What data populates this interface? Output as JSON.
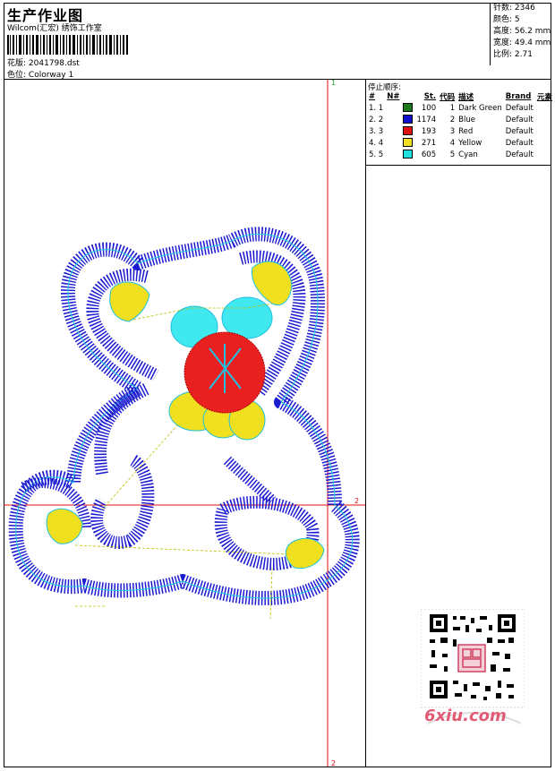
{
  "header": {
    "title": "生产作业图",
    "company": "Wilcom(汇宏) 绣饰工作室",
    "design_label": "花版:",
    "design_value": "2041798.dst",
    "colorway_label": "色位:",
    "colorway_value": "Colorway 1"
  },
  "stats": {
    "stitches": "针数: 2346",
    "colors": "颜色: 5",
    "height": "高度: 56.2 mm",
    "width": "宽度: 49.4 mm",
    "scale": "比例: 2.71"
  },
  "panel": {
    "stop_sequence_label": "停止顺序:",
    "columns": [
      "#",
      "N#",
      "",
      "St.",
      "代码",
      "描述",
      "Brand",
      "元素"
    ],
    "rows": [
      {
        "idx": "1. 1",
        "color": "#1a7a1a",
        "st": "100",
        "code": "1",
        "desc": "Dark Green",
        "brand": "Default"
      },
      {
        "idx": "2. 2",
        "color": "#1010cc",
        "st": "1174",
        "code": "2",
        "desc": "Blue",
        "brand": "Default"
      },
      {
        "idx": "3. 3",
        "color": "#e01010",
        "st": "193",
        "code": "3",
        "desc": "Red",
        "brand": "Default"
      },
      {
        "idx": "4. 4",
        "color": "#f0e020",
        "st": "271",
        "code": "4",
        "desc": "Yellow",
        "brand": "Default"
      },
      {
        "idx": "5. 5",
        "color": "#20e0e0",
        "st": "605",
        "code": "5",
        "desc": "Cyan",
        "brand": "Default"
      }
    ]
  },
  "canvas": {
    "marker_top": "1",
    "marker_right": "2",
    "marker_bottom": "2"
  },
  "watermark": {
    "site": "6xiu.com"
  }
}
